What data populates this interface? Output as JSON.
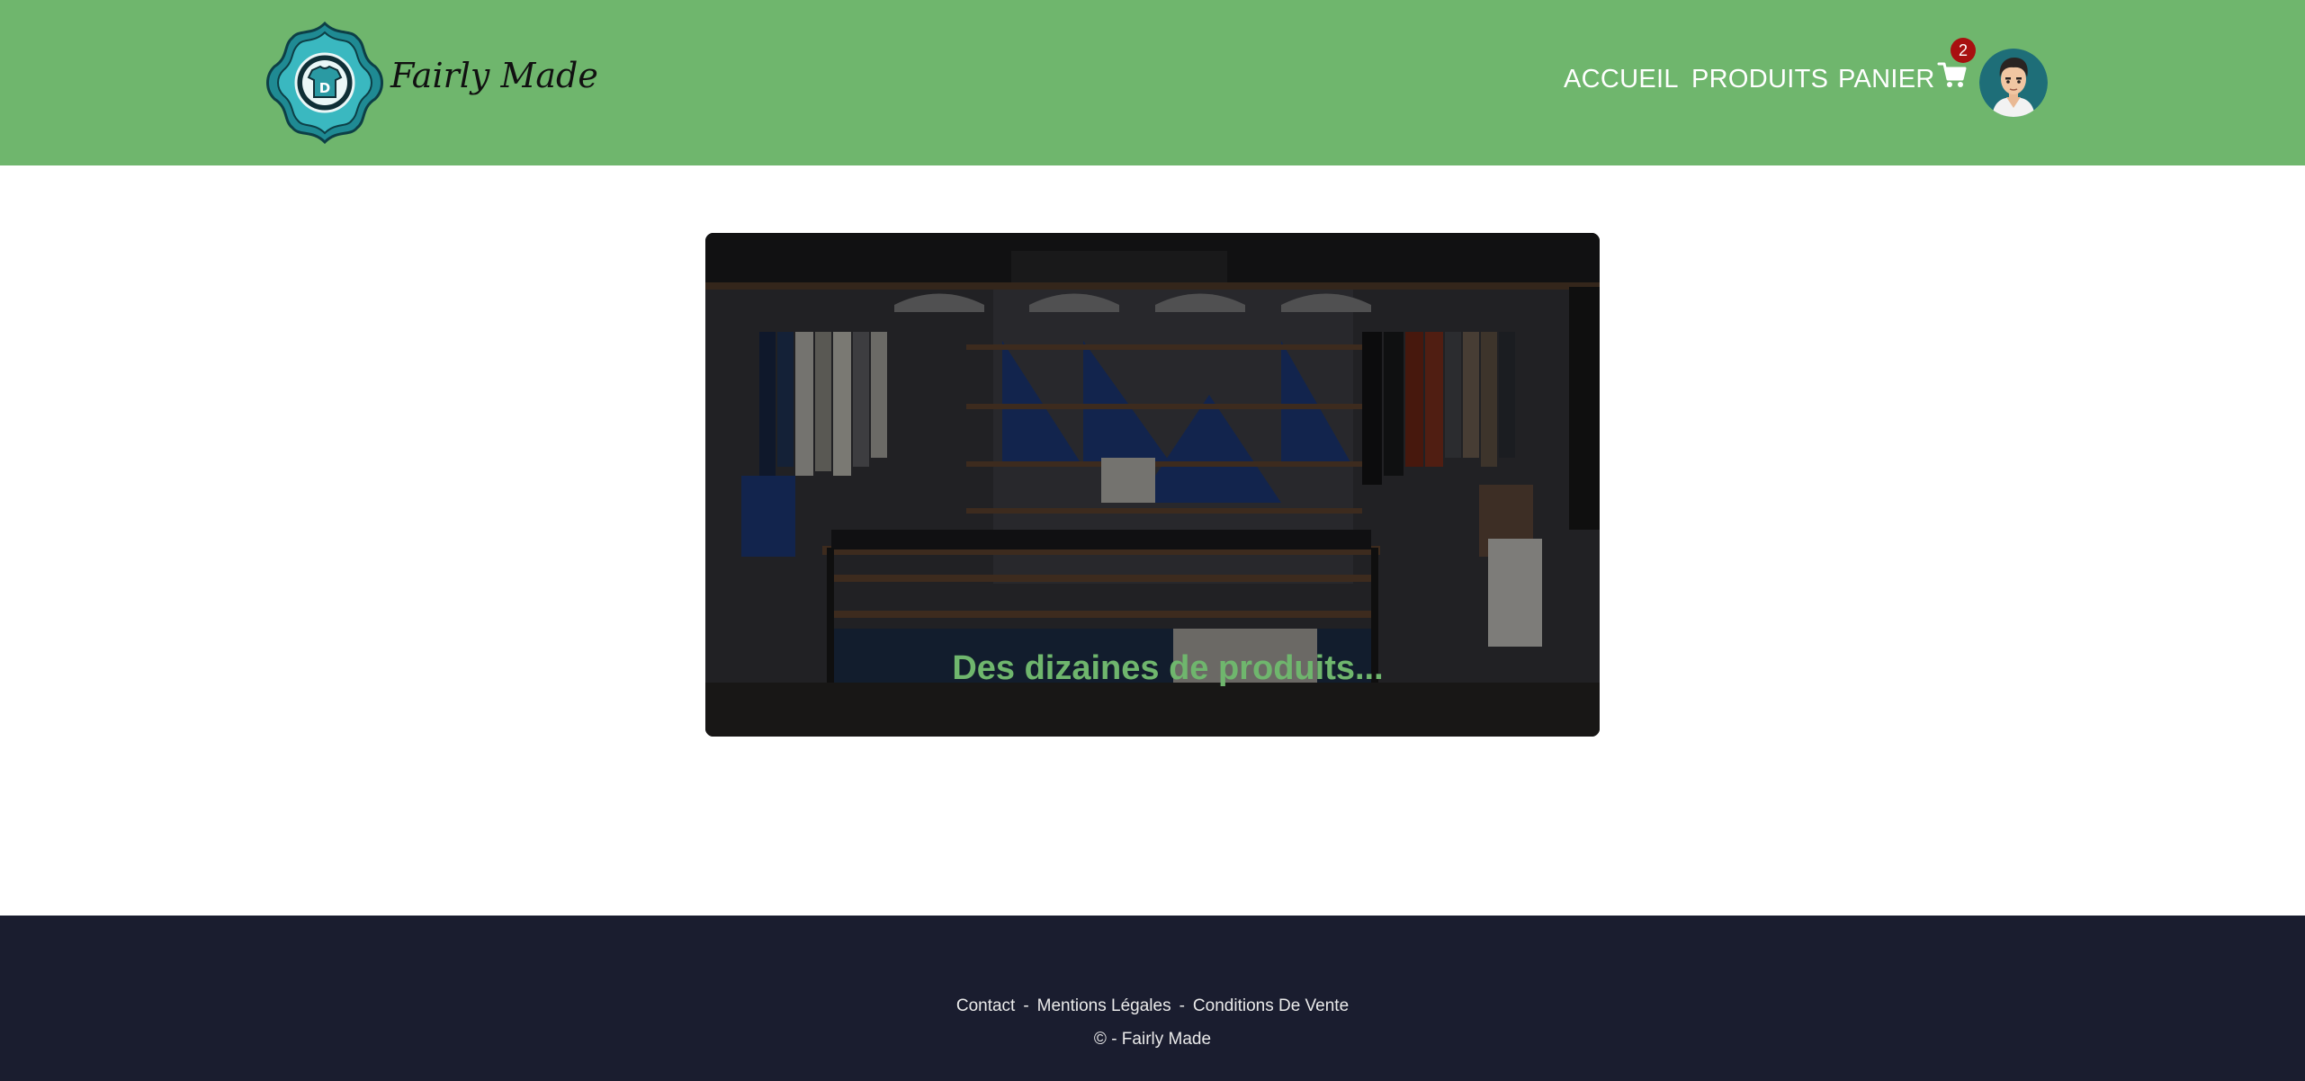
{
  "header": {
    "brand": "Fairly Made",
    "logo_badge": "D",
    "nav": {
      "home": "ACCUEIL",
      "products": "PRODUITS",
      "cart": "PANIER"
    },
    "cart_count": "2",
    "icons": {
      "cart": "shopping-cart-icon",
      "avatar": "user-avatar"
    },
    "colors": {
      "header_bg": "#6fb66d",
      "badge_bg": "#a81010"
    }
  },
  "hero": {
    "caption": "Des dizaines de produits...",
    "caption_color": "#6fb66d",
    "image": "clothing-store-interior"
  },
  "footer": {
    "links": [
      "Contact",
      "Mentions Légales",
      "Conditions De Vente"
    ],
    "separator": "-",
    "copyright": "© - Fairly Made",
    "bg": "#1a1d2f"
  }
}
